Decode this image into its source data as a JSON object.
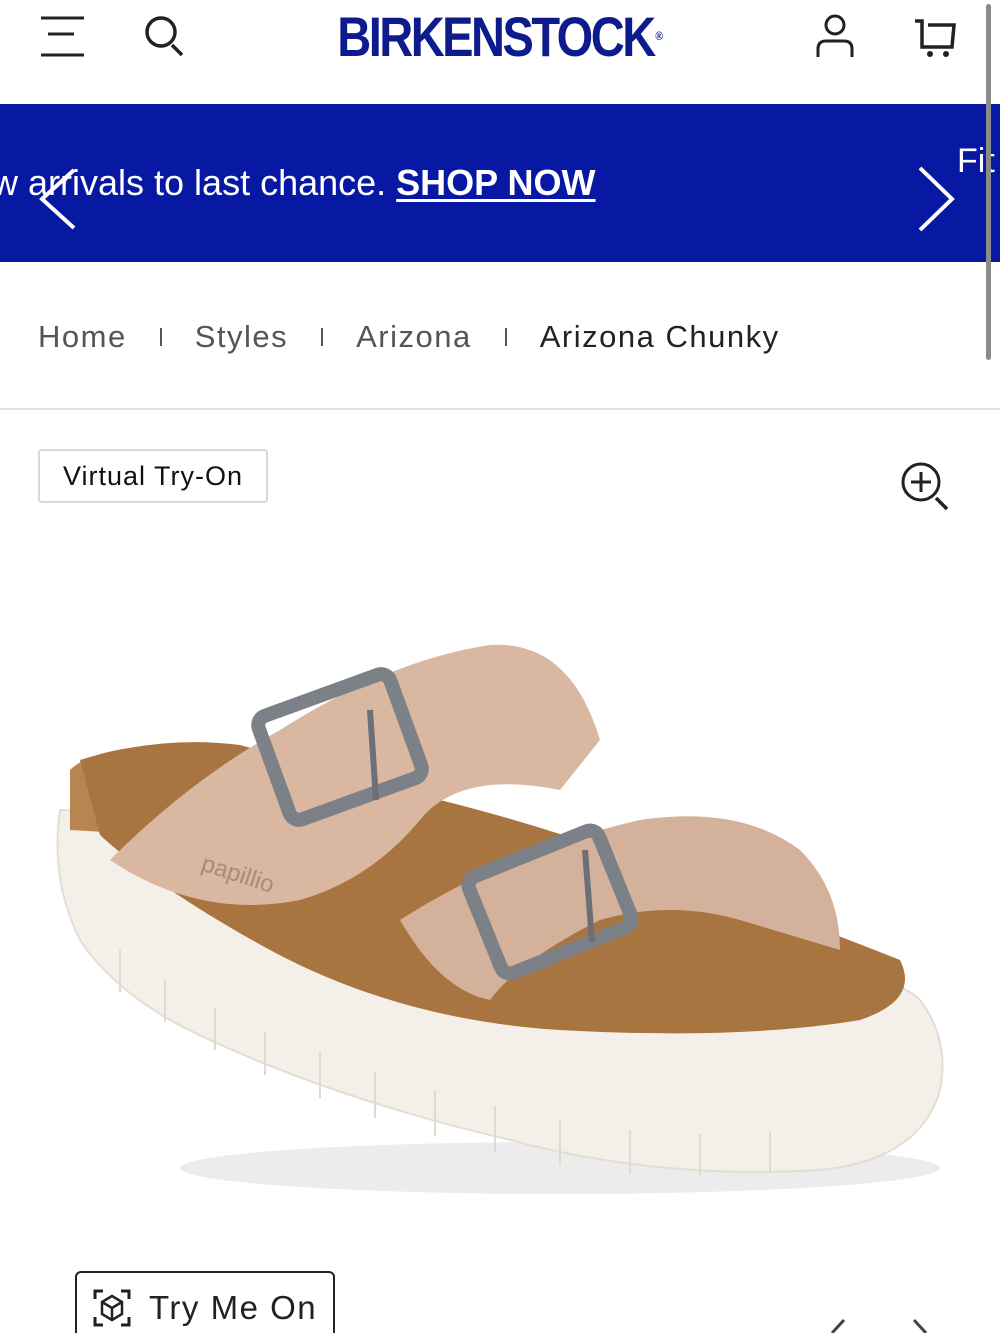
{
  "header": {
    "logo_text": "BIRKENSTOCK",
    "logo_mark": "®",
    "brand_color": "#0d1b8c",
    "icons": [
      "menu-icon",
      "search-icon",
      "account-icon",
      "cart-icon"
    ]
  },
  "promo": {
    "text": "w arrivals to last chance.",
    "link": "SHOP NOW",
    "next_slide_text": "Fit",
    "background": "#0718a3"
  },
  "breadcrumb": {
    "items": [
      "Home",
      "Styles",
      "Arizona",
      "Arizona Chunky"
    ]
  },
  "product": {
    "virtual_try_on": "Virtual Try-On",
    "try_me_on": "Try Me On",
    "sandal_logo": "papillio",
    "strap_color": "#d9b7a0",
    "sole_color": "#f4efe8",
    "footbed_color": "#a87440"
  }
}
